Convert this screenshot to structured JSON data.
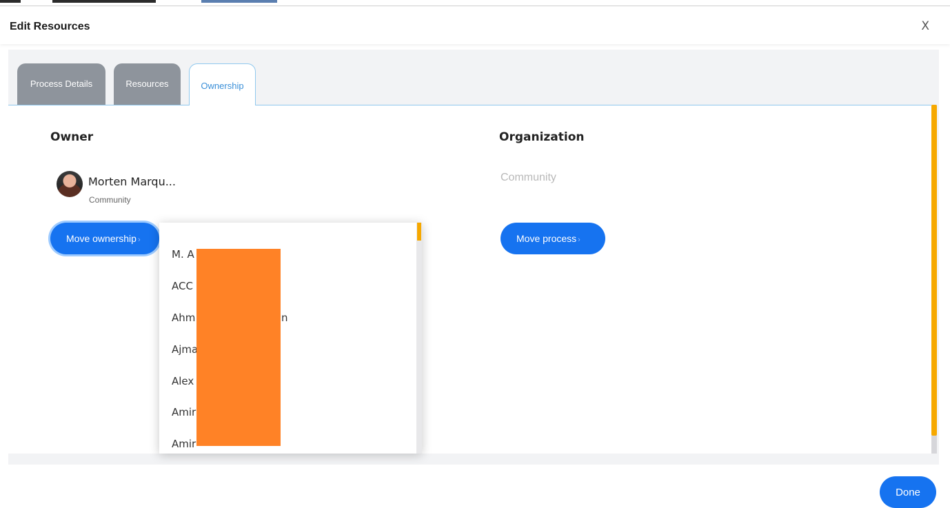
{
  "dialog": {
    "title": "Edit Resources",
    "close_label": "X",
    "done_label": "Done"
  },
  "tabs": [
    {
      "label": "Process Details",
      "active": false
    },
    {
      "label": "Resources",
      "active": false
    },
    {
      "label": "Ownership",
      "active": true
    }
  ],
  "owner": {
    "heading": "Owner",
    "name": "Morten Marqu...",
    "organization": "Community",
    "avatar_icon": "user-avatar-photo",
    "move_button_label": "Move ownership"
  },
  "organization": {
    "heading": "Organization",
    "value": "Community",
    "move_button_label": "Move process"
  },
  "ownership_dropdown": {
    "items": [
      "M. A",
      "ACC",
      "Ahm",
      "Ajma",
      "Alex",
      "Amir",
      "Amir"
    ],
    "partially_visible_suffix": "n",
    "redaction_color": "#ff8226"
  },
  "colors": {
    "primary_button": "#1673f0",
    "accent_scrollbar": "#f6a800",
    "active_tab_text": "#3a8fd8",
    "inactive_tab": "#8e949c"
  }
}
